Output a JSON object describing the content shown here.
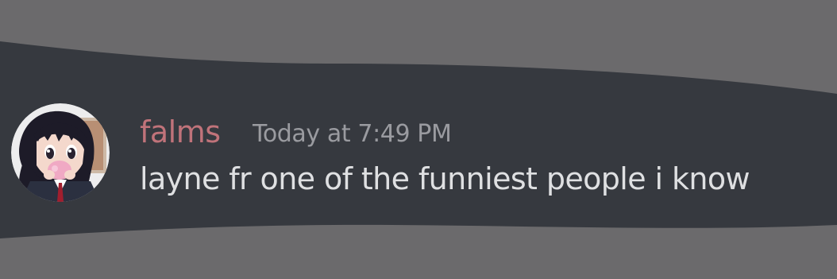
{
  "message": {
    "author": {
      "username": "falms",
      "avatar_icon": "anime-girl-avatar",
      "name_color": "#c0737a"
    },
    "timestamp": "Today at 7:49 PM",
    "text": "layne fr one of the funniest people i know"
  },
  "colors": {
    "outer_background": "#6b6a6c",
    "message_background": "#36393f",
    "text": "#dfe0e2",
    "timestamp": "#9a9ba0"
  }
}
